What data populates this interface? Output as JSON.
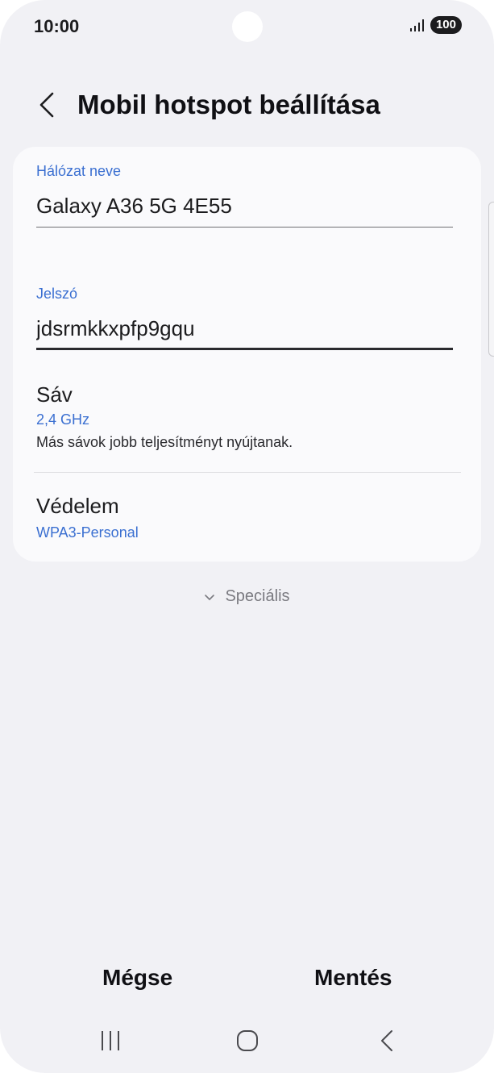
{
  "status_bar": {
    "time": "10:00",
    "battery": "100",
    "signal_icon": "signal-icon"
  },
  "header": {
    "title": "Mobil hotspot beállítása",
    "back_icon": "back-arrow-icon"
  },
  "network_name": {
    "label": "Hálózat neve",
    "value": "Galaxy A36 5G 4E55"
  },
  "password": {
    "label": "Jelszó",
    "value": "jdsrmkkxpfp9gqu"
  },
  "band": {
    "title": "Sáv",
    "value": "2,4 GHz",
    "description": "Más sávok jobb teljesítményt nyújtanak."
  },
  "security": {
    "title": "Védelem",
    "value": "WPA3-Personal"
  },
  "advanced": {
    "label": "Speciális",
    "icon": "chevron-down-icon"
  },
  "actions": {
    "cancel_label": "Mégse",
    "save_label": "Mentés"
  },
  "navigation": {
    "recents_icon": "recents-icon",
    "home_icon": "home-icon",
    "back_icon": "nav-back-icon"
  },
  "colors": {
    "accent": "#3a6fd1",
    "background": "#f1f1f5",
    "card": "#fafafc"
  }
}
